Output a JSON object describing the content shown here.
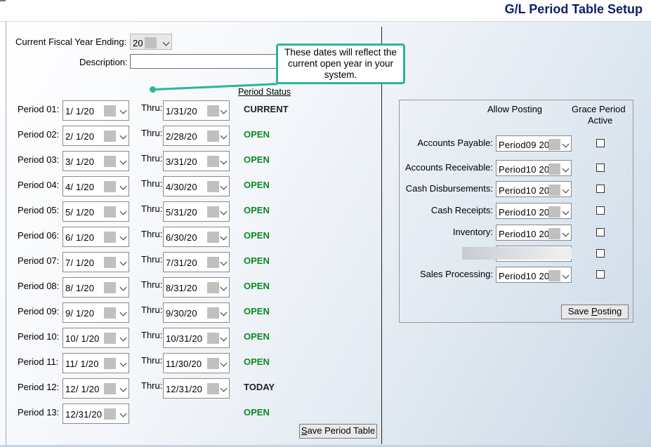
{
  "header": {
    "title": "G/L Period Table Setup"
  },
  "fiscal": {
    "label": "Current Fiscal Year Ending:",
    "value": "20",
    "description_label": "Description:",
    "description_value": ""
  },
  "callout": {
    "text": "These dates will reflect the current open year in your system."
  },
  "period_status_header": "Period Status",
  "thru_label": "Thru:",
  "periods": [
    {
      "label": "Period 01:",
      "start": "1/ 1/20",
      "end": "1/31/20",
      "status": "CURRENT"
    },
    {
      "label": "Period 02:",
      "start": "2/ 1/20",
      "end": "2/28/20",
      "status": "OPEN"
    },
    {
      "label": "Period 03:",
      "start": "3/ 1/20",
      "end": "3/31/20",
      "status": "OPEN"
    },
    {
      "label": "Period 04:",
      "start": "4/ 1/20",
      "end": "4/30/20",
      "status": "OPEN"
    },
    {
      "label": "Period 05:",
      "start": "5/ 1/20",
      "end": "5/31/20",
      "status": "OPEN"
    },
    {
      "label": "Period 06:",
      "start": "6/ 1/20",
      "end": "6/30/20",
      "status": "OPEN"
    },
    {
      "label": "Period 07:",
      "start": "7/ 1/20",
      "end": "7/31/20",
      "status": "OPEN"
    },
    {
      "label": "Period 08:",
      "start": "8/ 1/20",
      "end": "8/31/20",
      "status": "OPEN"
    },
    {
      "label": "Period 09:",
      "start": "9/ 1/20",
      "end": "9/30/20",
      "status": "OPEN"
    },
    {
      "label": "Period 10:",
      "start": "10/ 1/20",
      "end": "10/31/20",
      "status": "OPEN"
    },
    {
      "label": "Period 11:",
      "start": "11/ 1/20",
      "end": "11/30/20",
      "status": "OPEN"
    },
    {
      "label": "Period 12:",
      "start": "12/ 1/20",
      "end": "12/31/20",
      "status": "TODAY"
    },
    {
      "label": "Period 13:",
      "start": "12/31/20",
      "end": "",
      "status": "OPEN"
    }
  ],
  "save_period_table": {
    "prefix": "",
    "underlined": "S",
    "rest": "ave Period Table"
  },
  "posting": {
    "allow_posting_label": "Allow Posting",
    "grace_label_1": "Grace Period",
    "grace_label_2": "Active",
    "modules": [
      {
        "label": "Accounts Payable:",
        "value": "Period09 20"
      },
      {
        "label": "Accounts Receivable:",
        "value": "Period10 20"
      },
      {
        "label": "Cash Disbursements:",
        "value": "Period10 20"
      },
      {
        "label": "Cash Receipts:",
        "value": "Period10 20"
      },
      {
        "label": "Inventory:",
        "value": "Period10 20"
      },
      {
        "label": "",
        "value": ""
      },
      {
        "label": "Sales Processing:",
        "value": "Period10 20"
      }
    ],
    "save_posting": {
      "prefix": "Save ",
      "underlined": "P",
      "rest": "osting"
    }
  },
  "colors": {
    "open_status": "#0b8a22",
    "callout_border": "#2bb59a",
    "title": "#0f1f6b"
  }
}
